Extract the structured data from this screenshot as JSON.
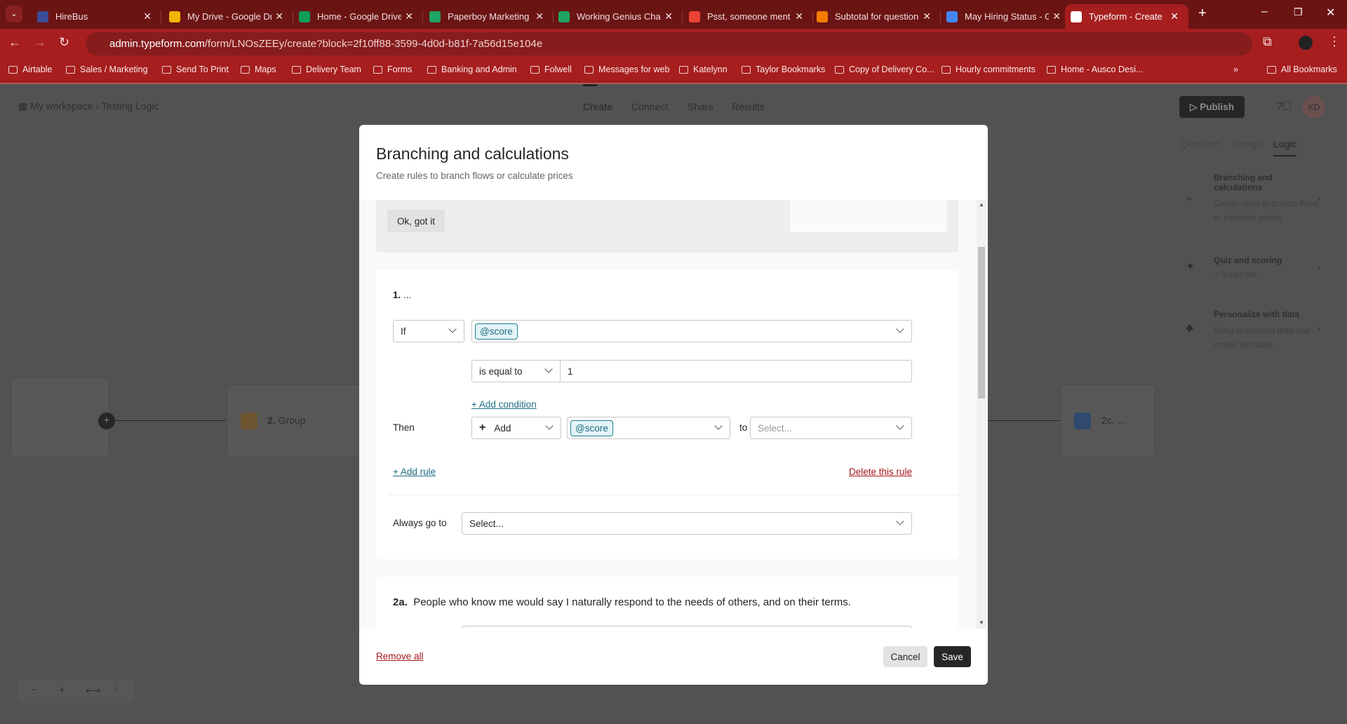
{
  "browser": {
    "tabs": [
      {
        "title": "HireBus",
        "color": "#3b4d9a"
      },
      {
        "title": "My Drive - Google Dr",
        "color": "#f4b400"
      },
      {
        "title": "Home - Google Drive",
        "color": "#0f9d58"
      },
      {
        "title": "Paperboy Marketing I",
        "color": "#1fa463"
      },
      {
        "title": "Working Genius Chat",
        "color": "#1fa463"
      },
      {
        "title": "Psst, someone ment",
        "color": "#ea4335"
      },
      {
        "title": "Subtotal for question",
        "color": "#f57c00"
      },
      {
        "title": "May Hiring Status - G",
        "color": "#4285f4"
      },
      {
        "title": "Typeform - Create",
        "color": "#ffffff",
        "active": true
      }
    ],
    "url_host": "admin.typeform.com",
    "url_path": "/form/LNOsZEEy/create?block=2f10ff88-3599-4d0d-b81f-7a56d15e104e",
    "bookmarks": [
      "Airtable",
      "Sales / Marketing",
      "Send To Print",
      "Maps",
      "Delivery Team",
      "Forms",
      "Banking and Admin",
      "Folwell",
      "Messages for web",
      "Katelynn",
      "Taylor Bookmarks",
      "Copy of Delivery Co...",
      "Hourly commitments",
      "Home - Ausco Desi..."
    ],
    "all_bookmarks": "All Bookmarks"
  },
  "app": {
    "workspace": "My workspace",
    "form_name": "Testing Logic",
    "nav": [
      "Create",
      "Connect",
      "Share",
      "Results"
    ],
    "publish": "Publish",
    "avatar": "KD",
    "panel_tabs": [
      "Question",
      "Design",
      "Logic"
    ],
    "panel_items": [
      {
        "title": "Branching and calculations",
        "desc": "Create rules to branch flows or calculate prices"
      },
      {
        "title": "Quiz and scoring",
        "desc": "Logic set"
      },
      {
        "title": "Personalize with data",
        "desc": "Bring in external data and create variables"
      }
    ],
    "nodes": {
      "group": "Group",
      "group_num": "2.",
      "right": "2c. ..."
    }
  },
  "modal": {
    "title": "Branching and calculations",
    "subtitle": "Create rules to branch flows or calculate prices",
    "ok_button": "Ok, got it",
    "rule1": {
      "heading_num": "1.",
      "heading": "...",
      "if_label": "If",
      "variable": "@score",
      "operator": "is equal to",
      "value": "1",
      "add_condition": "+ Add condition",
      "then_label": "Then",
      "action": "Add",
      "action_variable": "@score",
      "to_label": "to",
      "to_placeholder": "Select...",
      "add_rule": "+ Add rule",
      "delete_rule": "Delete this rule",
      "always_label": "Always go to",
      "always_value": "Select..."
    },
    "rule2": {
      "num": "2a.",
      "text": "People who know me would say I naturally respond to the needs of others, and on their terms."
    },
    "remove_all": "Remove all",
    "cancel": "Cancel",
    "save": "Save"
  }
}
